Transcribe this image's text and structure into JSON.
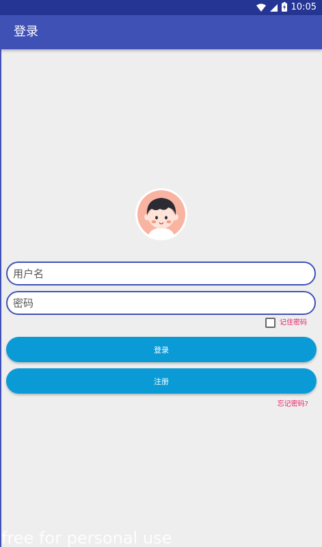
{
  "status_bar": {
    "time": "10:05",
    "icons": [
      "wifi-icon",
      "cellular-signal-icon",
      "battery-charging-icon"
    ]
  },
  "app_bar": {
    "title": "登录"
  },
  "login_form": {
    "username": {
      "value": "",
      "placeholder": "用户名"
    },
    "password": {
      "value": "",
      "placeholder": "密码"
    },
    "remember_password": {
      "label": "记住密码",
      "checked": false
    },
    "login_button_label": "登录",
    "register_button_label": "注册",
    "forgot_password_link": "忘记密码?"
  },
  "watermark": "free for personal use",
  "colors": {
    "status_bar": "#253593",
    "app_bar": "#3f51b5",
    "button": "#0a9bd7",
    "accent_text": "#e91e63",
    "background": "#eeeeee"
  }
}
